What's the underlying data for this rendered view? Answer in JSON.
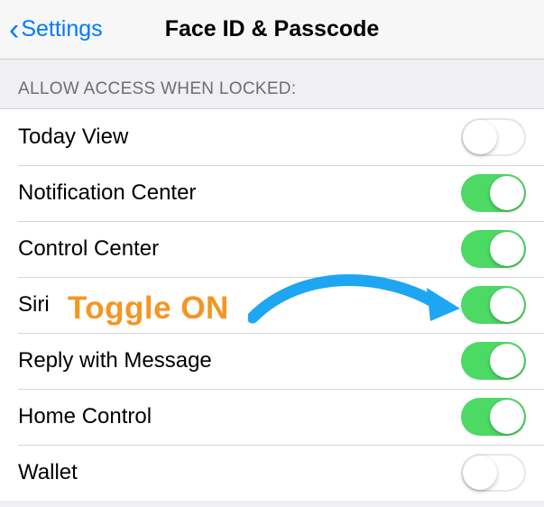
{
  "nav": {
    "back_label": "Settings",
    "title": "Face ID & Passcode"
  },
  "section_header": "ALLOW ACCESS WHEN LOCKED:",
  "rows": [
    {
      "label": "Today View",
      "on": false
    },
    {
      "label": "Notification Center",
      "on": true
    },
    {
      "label": "Control Center",
      "on": true
    },
    {
      "label": "Siri",
      "on": true
    },
    {
      "label": "Reply with Message",
      "on": true
    },
    {
      "label": "Home Control",
      "on": true
    },
    {
      "label": "Wallet",
      "on": false
    }
  ],
  "annotation": {
    "text": "Toggle ON",
    "color": "#f59523",
    "arrow_color": "#1ea6f2"
  }
}
